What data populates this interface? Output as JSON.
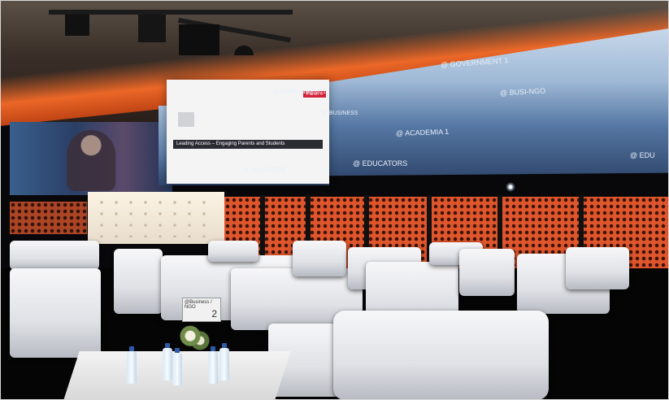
{
  "scene": {
    "description_kind": "photo",
    "colors": {
      "ceiling_glow": "#e0562c",
      "screen_sky": "#5577a3",
      "furniture": "#e6e8ec",
      "accent_red": "#d2233a"
    }
  },
  "screen": {
    "slide_tag": "Panel 4",
    "slide_title": "Leading Access – Engaging Parents and Students",
    "captions": {
      "government_label": "@ GOVERNMENT 1",
      "business_label": "@ BUSINESS",
      "business_ngo_label": "@ BUSI-NGO",
      "academia_label": "@ ACADEMIA 1",
      "educators_label": "@ EDUCATORS",
      "educators_label_2": "@ EDUCATORS",
      "edu_label": "@ EDU",
      "educators_label_3": "@ EDUCATORS"
    }
  },
  "table_card": {
    "label": "@Business / NGO",
    "number": "2"
  }
}
